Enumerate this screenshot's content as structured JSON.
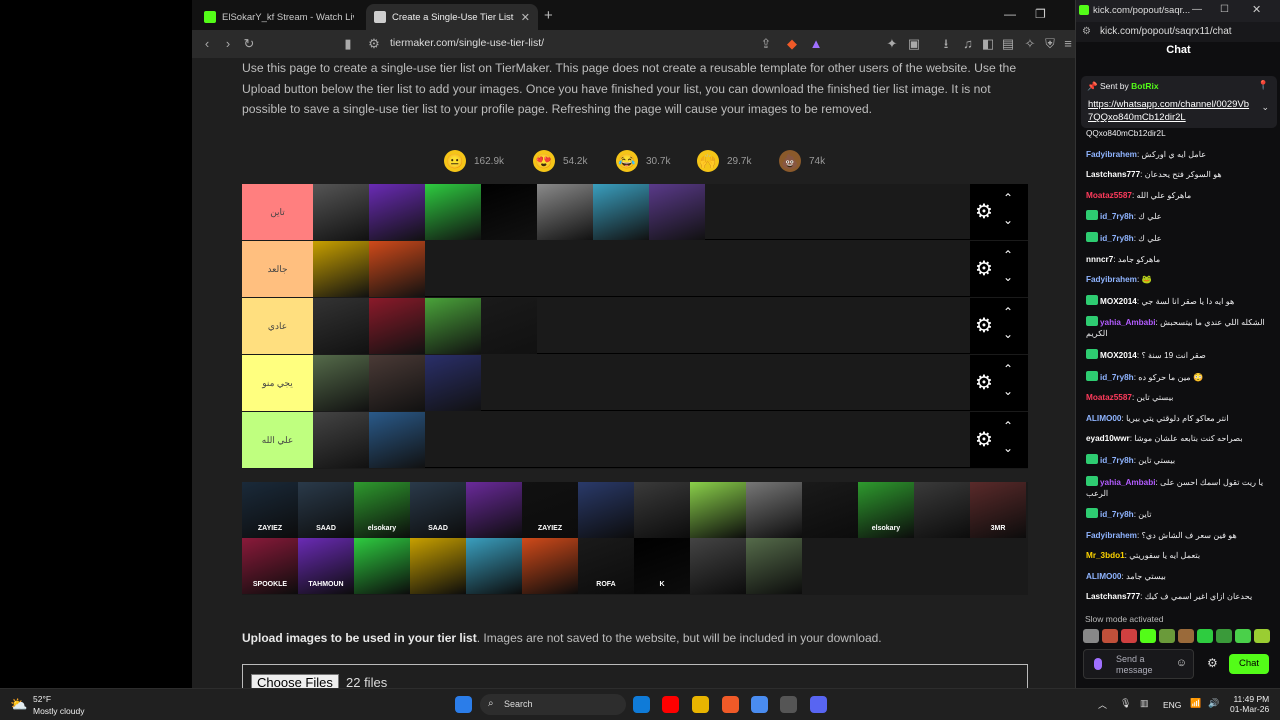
{
  "browser": {
    "tabs": [
      {
        "title": "ElSokarY_kf Stream - Watch Live on K",
        "active": false
      },
      {
        "title": "Create a Single-Use Tier List (Pro",
        "active": true
      }
    ],
    "url": "tiermaker.com/single-use-tier-list/"
  },
  "page": {
    "intro": "Use this page to create a single-use tier list on TierMaker. This page does not create a reusable template for other users of the website. Use the Upload button below the tier list to add your images. Once you have finished your list, you can download the finished tier list image. It is not possible to save a single-use tier list to your profile page. Refreshing the page will cause your images to be removed.",
    "reactions": [
      {
        "emoji": "😐",
        "count": "162.9k",
        "color": "#f5c518"
      },
      {
        "emoji": "😍",
        "count": "54.2k",
        "color": "#f5c518"
      },
      {
        "emoji": "😂",
        "count": "30.7k",
        "color": "#f5c518"
      },
      {
        "emoji": "🙌",
        "count": "29.7k",
        "color": "#f5c518"
      },
      {
        "emoji": "💩",
        "count": "74k",
        "color": "#8b5a2b"
      }
    ],
    "tiers": [
      {
        "label": "تاين",
        "color": "#ff7f7f",
        "items": [
          "#555",
          "#6a2bb5",
          "#2ecc40",
          "#000",
          "#8a8a8a",
          "#3a9fbf",
          "#5a3a8a"
        ]
      },
      {
        "label": "جالعد",
        "color": "#ffbf7f",
        "items": [
          "#c8a000",
          "#d04a1a"
        ]
      },
      {
        "label": "عادي",
        "color": "#ffdf7f",
        "items": [
          "#333",
          "#8b1a2a",
          "#4aa33a",
          "#1a1a1a"
        ]
      },
      {
        "label": "يجي منو",
        "color": "#ffff7f",
        "items": [
          "#556b4a",
          "#4a3a36",
          "#2a2f6a"
        ]
      },
      {
        "label": "علي الله",
        "color": "#bfff7f",
        "items": [
          "#444",
          "#2a5a8a"
        ]
      }
    ],
    "pool_items": [
      "#1a2a3a",
      "#2a3a4a",
      "#2e9a2e",
      "#2a3a4a",
      "#6a2a9a",
      "#111",
      "#2a3a6a",
      "#3a3a3a",
      "#8ad04a",
      "#777",
      "#1a1a1a",
      "#2e9a2e",
      "#3a3a3a",
      "#5a2a2a",
      "#8a1a3a",
      "#6a2bb5",
      "#2ecc40",
      "#c8a000",
      "#3a9fbf",
      "#d04a1a",
      "#1a1a1a",
      "#000",
      "#444",
      "#556b4a"
    ],
    "pool_labels": {
      "0": "ZAYIEZ",
      "1": "SAAD",
      "2": "elsokary",
      "3": "SAAD",
      "5": "ZAYIEZ",
      "11": "elsokary",
      "13": "3MR",
      "14": "SPOOKLE",
      "15": "TAHMOUN",
      "20": "ROFA",
      "21": "K"
    },
    "upload_bold": "Upload images to be used in your tier list",
    "upload_rest": ". Images are not saved to the website, but will be included in your download.",
    "choose_files": "Choose Files",
    "file_count": "22 files"
  },
  "chat": {
    "window_title": "kick.com/popout/saqr...",
    "url": "kick.com/popout/saqrx11/chat",
    "header": "Chat",
    "pinned_sender": "Sent by",
    "pinned_bot": "BotRix",
    "pinned_link": "https://whatsapp.com/channel/0029Vb7QQxo840mCb12dir2L",
    "messages": [
      {
        "user": "",
        "color": "#efeff1",
        "text": "QQxo840mCb12dir2L",
        "badge": false
      },
      {
        "user": "Fadyibrahem",
        "color": "#8fb4ff",
        "text": "عامل ايه ي اوركش",
        "badge": false
      },
      {
        "user": "Lastchans777",
        "color": "#ffffff",
        "text": "هو السوكر فتح يحدعان",
        "badge": false
      },
      {
        "user": "Moataz5587",
        "color": "#ff3b5c",
        "text": "ماهركو علي الله",
        "badge": false
      },
      {
        "user": "id_7ry8h",
        "color": "#8fb4ff",
        "text": "علي ك",
        "badge": true
      },
      {
        "user": "id_7ry8h",
        "color": "#8fb4ff",
        "text": "علي ك",
        "badge": true
      },
      {
        "user": "nnncr7",
        "color": "#ffffff",
        "text": "ماهركو جامد",
        "badge": false
      },
      {
        "user": "Fadyibrahem",
        "color": "#8fb4ff",
        "text": "🐸",
        "badge": false
      },
      {
        "user": "MOX2014",
        "color": "#ffffff",
        "text": "هو ايه دا يا صقر انا لسة جي",
        "badge": true
      },
      {
        "user": "yahia_Ambabi",
        "color": "#b35cff",
        "text": "الشكله اللي عندي ما بيتسحبش الكريم",
        "badge": true
      },
      {
        "user": "MOX2014",
        "color": "#ffffff",
        "text": "صقر انت 19 سنة ؟",
        "badge": true
      },
      {
        "user": "id_7ry8h",
        "color": "#8fb4ff",
        "text": "مين ما حركو ده 😳",
        "badge": true
      },
      {
        "user": "Moataz5587",
        "color": "#ff3b5c",
        "text": "بيستي تاين",
        "badge": false
      },
      {
        "user": "ALIMO00",
        "color": "#8fb4ff",
        "text": "انتر معاكو كام دلوقتي يتي بيريا",
        "badge": false
      },
      {
        "user": "eyad10wwr",
        "color": "#ffffff",
        "text": "بصراحه كنت بتابعه علشان موشا",
        "badge": false
      },
      {
        "user": "id_7ry8h",
        "color": "#8fb4ff",
        "text": "بيستي تاين",
        "badge": true
      },
      {
        "user": "yahia_Ambabi",
        "color": "#b35cff",
        "text": "يا ريت تقول اسمك احسن على الرعب",
        "badge": true
      },
      {
        "user": "id_7ry8h",
        "color": "#8fb4ff",
        "text": "تاين",
        "badge": true
      },
      {
        "user": "Fadyibrahem",
        "color": "#8fb4ff",
        "text": "هو فين سعر ف الشاش دي؟",
        "badge": false
      },
      {
        "user": "Mr_3bdo1",
        "color": "#ffd500",
        "text": "بتعمل ايه يا سفوريتي",
        "badge": false
      },
      {
        "user": "ALIMO00",
        "color": "#8fb4ff",
        "text": "بيستي جامد",
        "badge": false
      },
      {
        "user": "Lastchans777",
        "color": "#ffffff",
        "text": "يحدعان ازاي اغير اسمي ف كيك",
        "badge": false
      }
    ],
    "slow_mode": "Slow mode activated",
    "send_placeholder": "Send a message",
    "chat_button": "Chat"
  },
  "taskbar": {
    "temp": "52°F",
    "weather": "Mostly cloudy",
    "search": "Search",
    "lang": "ENG",
    "time": "11:49 PM",
    "date": "01-Mar-26"
  }
}
